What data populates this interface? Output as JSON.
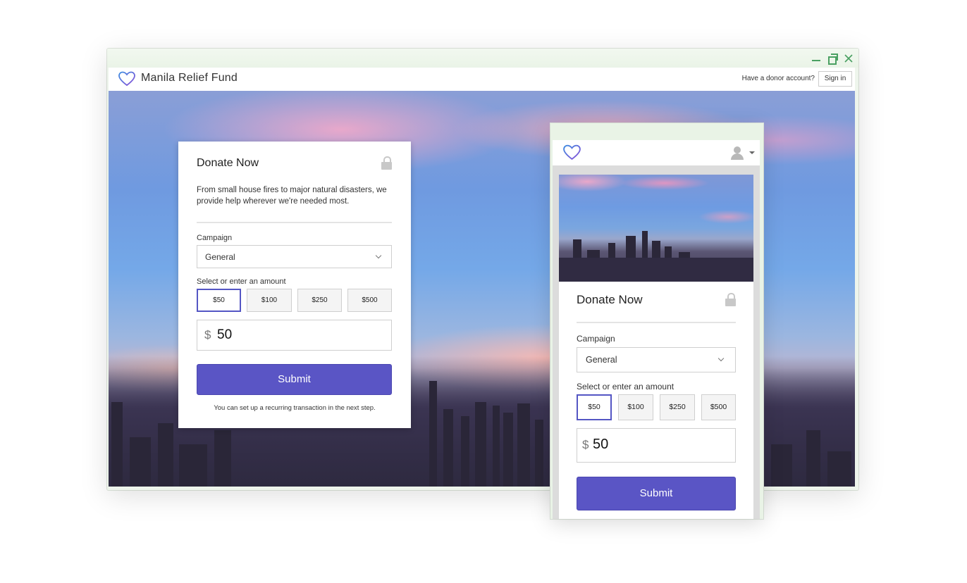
{
  "desktop": {
    "site_title": "Manila Relief Fund",
    "donor_question": "Have a donor account?",
    "sign_in_label": "Sign in",
    "window_controls": [
      "minimize-icon",
      "restore-icon",
      "close-icon"
    ]
  },
  "donate_card": {
    "title": "Donate Now",
    "description": "From small house fires to major natural disasters, we provide help wherever we're needed most.",
    "campaign_label": "Campaign",
    "campaign_value": "General",
    "amount_label": "Select or enter an amount",
    "amount_options": [
      "$50",
      "$100",
      "$250",
      "$500"
    ],
    "selected_amount": "$50",
    "currency_symbol": "$",
    "amount_value": "50",
    "submit_label": "Submit",
    "recurring_note": "You can set up a recurring transaction in the next step."
  },
  "mobile": {
    "title": "Donate Now",
    "campaign_label": "Campaign",
    "campaign_value": "General",
    "amount_label": "Select or enter an amount",
    "amount_options": [
      "$50",
      "$100",
      "$250",
      "$500"
    ],
    "selected_amount": "$50",
    "currency_symbol": "$",
    "amount_value": "50",
    "submit_label": "Submit"
  },
  "colors": {
    "accent": "#5a55c5",
    "window_frame": "#e9f3e6",
    "window_controls": "#4aa062"
  }
}
